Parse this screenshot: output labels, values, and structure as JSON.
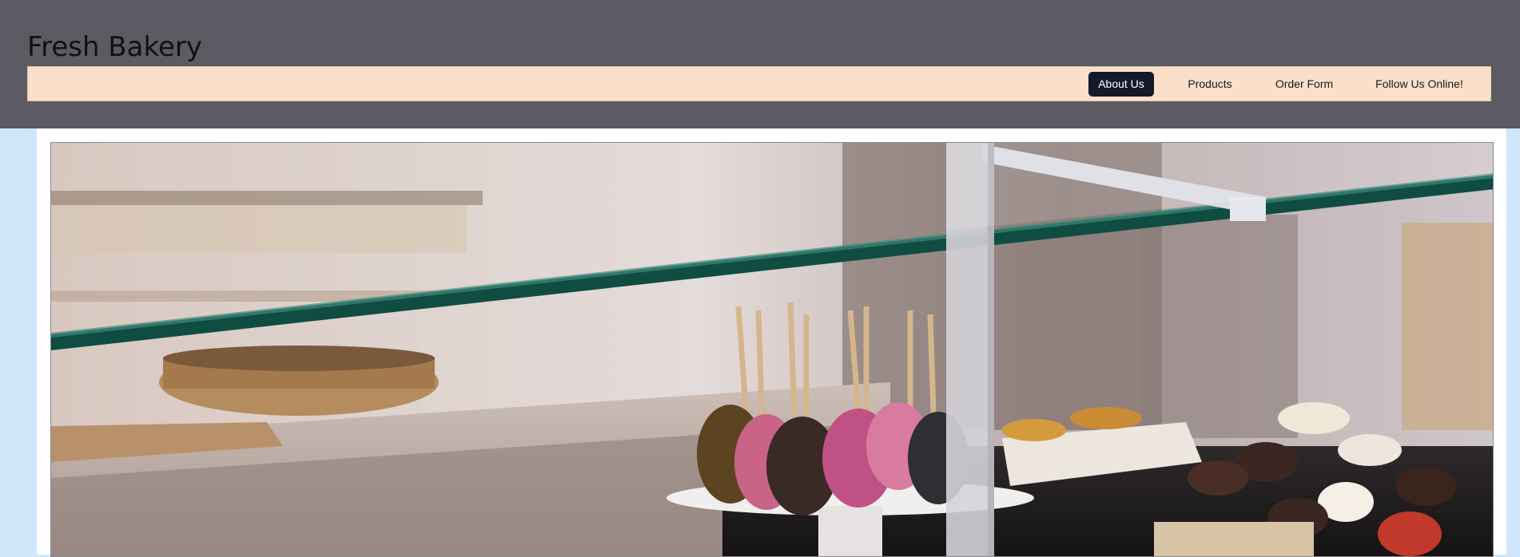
{
  "header": {
    "site_title": "Fresh Bakery",
    "background_color": "#5c5b63"
  },
  "nav": {
    "background_color": "#fcdfc8",
    "items": [
      {
        "label": "About Us",
        "active": true
      },
      {
        "label": "Products",
        "active": false
      },
      {
        "label": "Order Form",
        "active": false
      },
      {
        "label": "Follow Us Online!",
        "active": false
      }
    ]
  },
  "page": {
    "background_color": "#cfe6fb",
    "content_background": "#ffffff"
  }
}
